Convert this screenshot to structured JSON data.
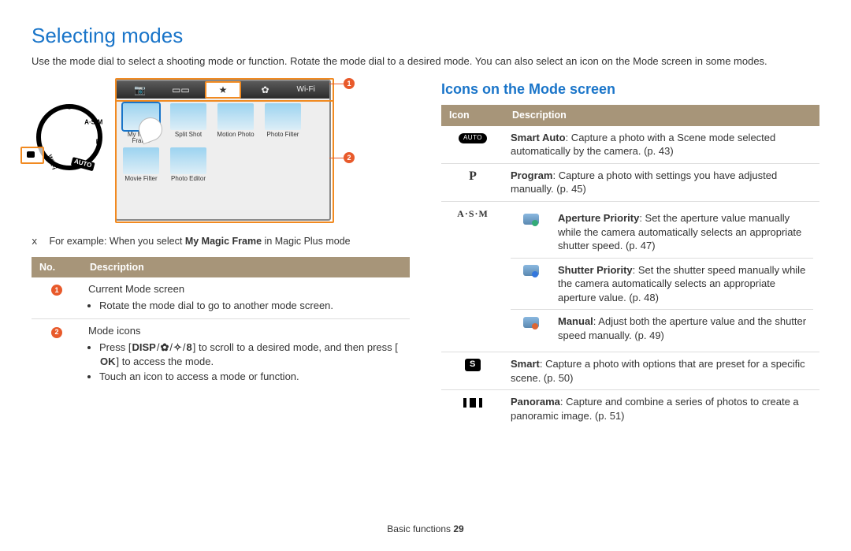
{
  "title": "Selecting modes",
  "intro": "Use the mode dial to select a shooting mode or function. Rotate the mode dial to a desired mode. You can also select an icon on the Mode screen in some modes.",
  "figure": {
    "tabs": [
      {
        "glyph": "📷",
        "name": "camera"
      },
      {
        "glyph": "▭▭",
        "name": "panorama"
      },
      {
        "glyph": "★",
        "name": "magic-plus",
        "active": true
      },
      {
        "glyph": "✿",
        "name": "settings"
      },
      {
        "label": "Wi-Fi",
        "name": "wifi"
      }
    ],
    "apps": [
      {
        "label": "My Magic Frame",
        "selected": true
      },
      {
        "label": "Split Shot"
      },
      {
        "label": "Motion Photo"
      },
      {
        "label": "Photo Filter"
      },
      {
        "label": "Movie Filter"
      },
      {
        "label": "Photo Editor"
      }
    ],
    "dial_labels": [
      "AUTO",
      "P",
      "A·S·M",
      "S",
      "Wi-Fi"
    ]
  },
  "example_prefix": "For example: When you select ",
  "example_bold": "My Magic Frame",
  "example_suffix": " in Magic Plus mode",
  "left_table": {
    "headers": [
      "No.",
      "Description"
    ],
    "rows": [
      {
        "num": "1",
        "title": "Current Mode screen",
        "bullets": [
          "Rotate the mode dial to go to another mode screen."
        ]
      },
      {
        "num": "2",
        "title": "Mode icons",
        "bullets": [
          "Press [DISP/⌘/❉/8] to scroll to a desired mode, and then press [OK] to access the mode.",
          "Touch an icon to access a mode or function."
        ],
        "press_tokens": [
          "DISP",
          "✿",
          "✧",
          "8"
        ],
        "ok_token": "OK"
      }
    ]
  },
  "right_heading": "Icons on the Mode screen",
  "right_table": {
    "headers": [
      "Icon",
      "Description"
    ],
    "rows": [
      {
        "icon": "auto",
        "desc_bold": "Smart Auto",
        "desc": ": Capture a photo with a Scene mode selected automatically by the camera. (p. 43)"
      },
      {
        "icon": "P",
        "desc_bold": "Program",
        "desc": ": Capture a photo with settings you have adjusted manually. (p. 45)"
      },
      {
        "icon": "asm",
        "sub": [
          {
            "sub_icon": "a",
            "desc_bold": "Aperture Priority",
            "desc": ": Set the aperture value manually while the camera automatically selects an appropriate shutter speed. (p. 47)"
          },
          {
            "sub_icon": "s",
            "desc_bold": "Shutter Priority",
            "desc": ": Set the shutter speed manually while the camera automatically selects an appropriate aperture value. (p. 48)"
          },
          {
            "sub_icon": "m",
            "desc_bold": "Manual",
            "desc": ": Adjust both the aperture value and the shutter speed manually. (p. 49)"
          }
        ]
      },
      {
        "icon": "smart",
        "desc_bold": "Smart",
        "desc": ": Capture a photo with options that are preset for a specific scene. (p. 50)"
      },
      {
        "icon": "pano",
        "desc_bold": "Panorama",
        "desc": ": Capture and combine a series of photos to create a panoramic image. (p. 51)"
      }
    ]
  },
  "footer_section": "Basic functions",
  "footer_page": "29"
}
